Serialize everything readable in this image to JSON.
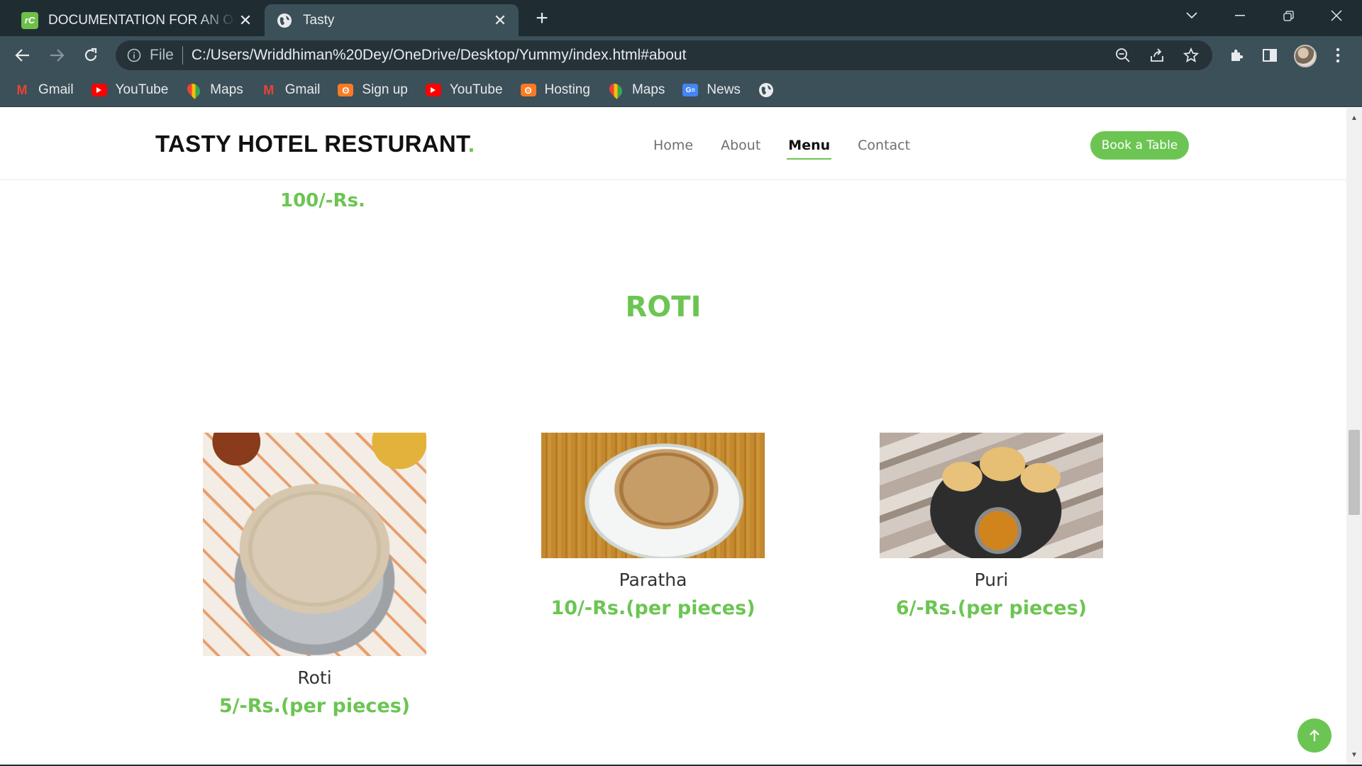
{
  "browser": {
    "tabs": [
      {
        "title": "DOCUMENTATION FOR AN ONLINE",
        "favicon": "rc-icon",
        "active": false
      },
      {
        "title": "Tasty",
        "favicon": "globe-icon",
        "active": true
      }
    ],
    "address": {
      "scheme_label": "File",
      "url": "C:/Users/Wriddhiman%20Dey/OneDrive/Desktop/Yummy/index.html#about"
    },
    "bookmarks": [
      {
        "label": "Gmail",
        "icon": "gmail-icon"
      },
      {
        "label": "YouTube",
        "icon": "youtube-icon"
      },
      {
        "label": "Maps",
        "icon": "maps-icon"
      },
      {
        "label": "Gmail",
        "icon": "gmail-icon"
      },
      {
        "label": "Sign up",
        "icon": "xampp-icon"
      },
      {
        "label": "YouTube",
        "icon": "youtube-icon"
      },
      {
        "label": "Hosting",
        "icon": "xampp-icon"
      },
      {
        "label": "Maps",
        "icon": "maps-icon"
      },
      {
        "label": "News",
        "icon": "news-icon"
      }
    ]
  },
  "site": {
    "logo": "TASTY HOTEL RESTURANT",
    "logo_dot": ".",
    "nav": [
      "Home",
      "About",
      "Menu",
      "Contact"
    ],
    "active_nav": "Menu",
    "cta": "Book a Table",
    "accent_color": "#6cc552"
  },
  "menu": {
    "previous_price": "100/-Rs.",
    "section_title": "ROTI",
    "items": [
      {
        "name": "Roti",
        "price": "5/-Rs.(per pieces)"
      },
      {
        "name": "Paratha",
        "price": "10/-Rs.(per pieces)"
      },
      {
        "name": "Puri",
        "price": "6/-Rs.(per pieces)"
      }
    ]
  }
}
